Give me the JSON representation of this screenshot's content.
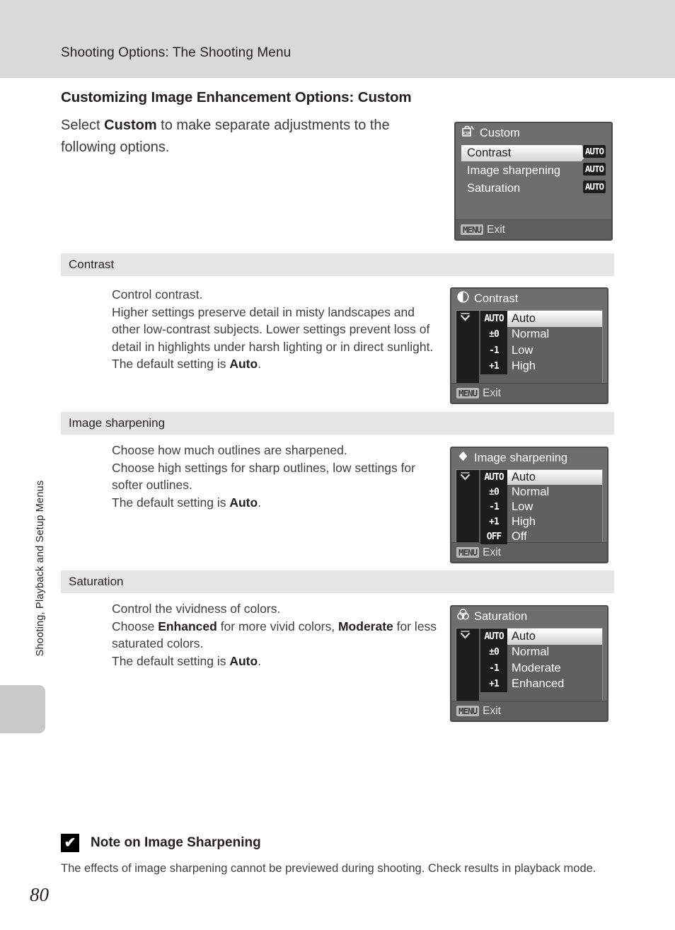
{
  "header": {
    "running_title": "Shooting Options: The Shooting Menu"
  },
  "sidebar": {
    "vertical_label": "Shooting, Playback and Setup Menus",
    "page_number": "80"
  },
  "page": {
    "section_title": "Customizing Image Enhancement Options: Custom",
    "intro_pre": "Select ",
    "intro_bold": "Custom",
    "intro_post": " to make separate adjustments to the following options."
  },
  "sections": [
    {
      "bar_label": "Contrast",
      "lines": [
        "Control contrast.",
        "Higher settings preserve detail in misty landscapes and other low-contrast subjects. Lower settings prevent loss of detail in highlights under harsh lighting or in direct sunlight.",
        "The default setting is Auto."
      ],
      "default_word": "Auto"
    },
    {
      "bar_label": "Image sharpening",
      "lines": [
        "Choose how much outlines are sharpened.",
        "Choose high settings for sharp outlines, low settings for softer outlines.",
        "The default setting is Auto."
      ],
      "default_word": "Auto"
    },
    {
      "bar_label": "Saturation",
      "lines": [
        "Control the vividness of colors.",
        "Choose Enhanced for more vivid colors, Moderate for less saturated colors.",
        "The default setting is Auto."
      ],
      "default_word": "Auto",
      "bold_words": [
        "Enhanced",
        "Moderate"
      ]
    }
  ],
  "screens": {
    "custom": {
      "icon": "csm-icon",
      "title": "Custom",
      "exit_chip": "MENU",
      "exit_label": "Exit",
      "rows": [
        {
          "label": "Contrast",
          "value": "AUTO",
          "selected": true
        },
        {
          "label": "Image sharpening",
          "value": "AUTO",
          "selected": false
        },
        {
          "label": "Saturation",
          "value": "AUTO",
          "selected": false
        }
      ]
    },
    "contrast": {
      "icon": "contrast-icon",
      "title": "Contrast",
      "exit_chip": "MENU",
      "exit_label": "Exit",
      "options": [
        {
          "value": "AUTO",
          "label": "Auto",
          "selected": true,
          "marked": true
        },
        {
          "value": "±0",
          "label": "Normal",
          "selected": false,
          "marked": false
        },
        {
          "value": "-1",
          "label": "Low",
          "selected": false,
          "marked": false
        },
        {
          "value": "+1",
          "label": "High",
          "selected": false,
          "marked": false
        }
      ]
    },
    "sharpening": {
      "icon": "sharpening-icon",
      "title": "Image sharpening",
      "exit_chip": "MENU",
      "exit_label": "Exit",
      "options": [
        {
          "value": "AUTO",
          "label": "Auto",
          "selected": true,
          "marked": true
        },
        {
          "value": "±0",
          "label": "Normal",
          "selected": false,
          "marked": false
        },
        {
          "value": "-1",
          "label": "Low",
          "selected": false,
          "marked": false
        },
        {
          "value": "+1",
          "label": "High",
          "selected": false,
          "marked": false
        },
        {
          "value": "OFF",
          "label": "Off",
          "selected": false,
          "marked": false
        }
      ]
    },
    "saturation": {
      "icon": "saturation-icon",
      "title": "Saturation",
      "exit_chip": "MENU",
      "exit_label": "Exit",
      "options": [
        {
          "value": "AUTO",
          "label": "Auto",
          "selected": true,
          "marked": true
        },
        {
          "value": "±0",
          "label": "Normal",
          "selected": false,
          "marked": false
        },
        {
          "value": "-1",
          "label": "Moderate",
          "selected": false,
          "marked": false
        },
        {
          "value": "+1",
          "label": "Enhanced",
          "selected": false,
          "marked": false
        }
      ]
    }
  },
  "note": {
    "icon": "checkmark-note-icon",
    "icon_glyph": "✔",
    "title": "Note on Image Sharpening",
    "body": "The effects of image sharpening cannot be previewed during shooting. Check results in playback mode."
  },
  "colors": {
    "header_band": "#d9d9d9",
    "bar": "#e6e6e6",
    "lcd_bg": "#6e6e6e",
    "lcd_dark": "#1d1d1d",
    "text": "#231f20"
  }
}
